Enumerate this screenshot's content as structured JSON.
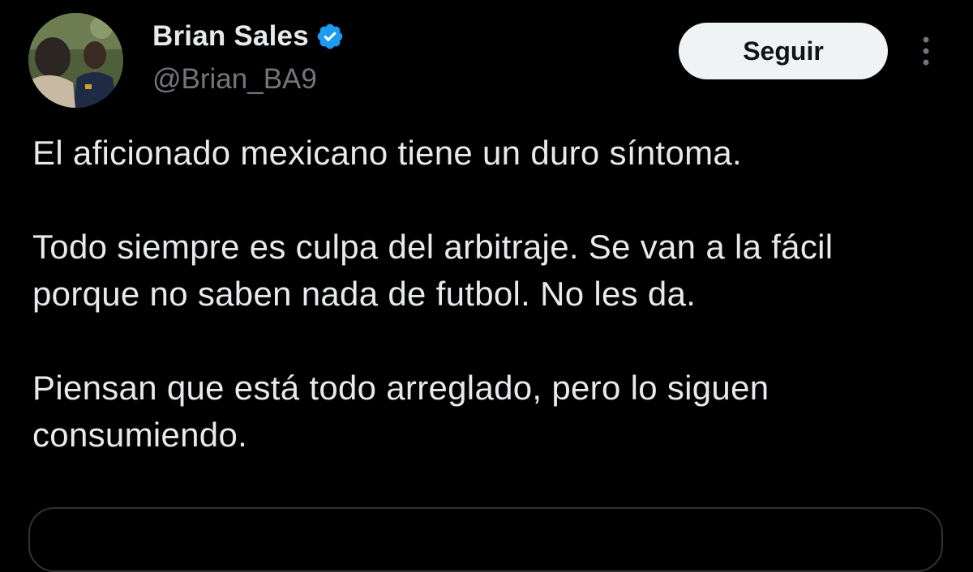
{
  "author": {
    "display_name": "Brian Sales",
    "handle": "@Brian_BA9",
    "verified": true
  },
  "actions": {
    "follow_label": "Seguir",
    "more_icon": "more-vertical-icon"
  },
  "tweet": {
    "paragraphs": [
      "El aficionado mexicano tiene un duro síntoma.",
      "Todo siempre es culpa del arbitraje. Se van a la fácil porque no saben nada de futbol. No les da.",
      "Piensan que está todo arreglado, pero lo siguen consumiendo."
    ]
  },
  "colors": {
    "background": "#000000",
    "text_primary": "#e7e9ea",
    "text_secondary": "#71767b",
    "verified_blue": "#1d9bf0",
    "follow_button_bg": "#eff3f4"
  }
}
